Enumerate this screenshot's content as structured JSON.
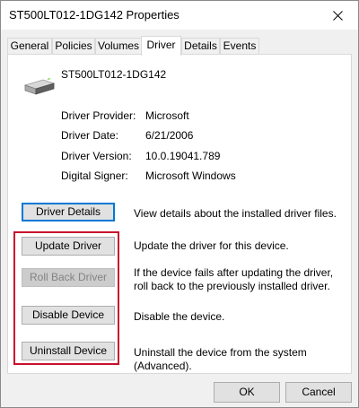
{
  "window": {
    "title": "ST500LT012-1DG142 Properties"
  },
  "tabs": [
    {
      "label": "General"
    },
    {
      "label": "Policies"
    },
    {
      "label": "Volumes"
    },
    {
      "label": "Driver"
    },
    {
      "label": "Details"
    },
    {
      "label": "Events"
    }
  ],
  "device": {
    "name": "ST500LT012-1DG142",
    "icon": "drive-icon"
  },
  "properties": [
    {
      "label": "Driver Provider:",
      "value": "Microsoft"
    },
    {
      "label": "Driver Date:",
      "value": "6/21/2006"
    },
    {
      "label": "Driver Version:",
      "value": "10.0.19041.789"
    },
    {
      "label": "Digital Signer:",
      "value": "Microsoft Windows"
    }
  ],
  "actions": [
    {
      "label": "Driver Details",
      "description": "View details about the installed driver files."
    },
    {
      "label": "Update Driver",
      "description": "Update the driver for this device."
    },
    {
      "label": "Roll Back Driver",
      "description": "If the device fails after updating the driver, roll back to the previously installed driver."
    },
    {
      "label": "Disable Device",
      "description": "Disable the device."
    },
    {
      "label": "Uninstall Device",
      "description": "Uninstall the device from the system (Advanced)."
    }
  ],
  "footer": {
    "ok_label": "OK",
    "cancel_label": "Cancel"
  },
  "colors": {
    "highlight": "#c8102e",
    "focus": "#0078d7"
  }
}
